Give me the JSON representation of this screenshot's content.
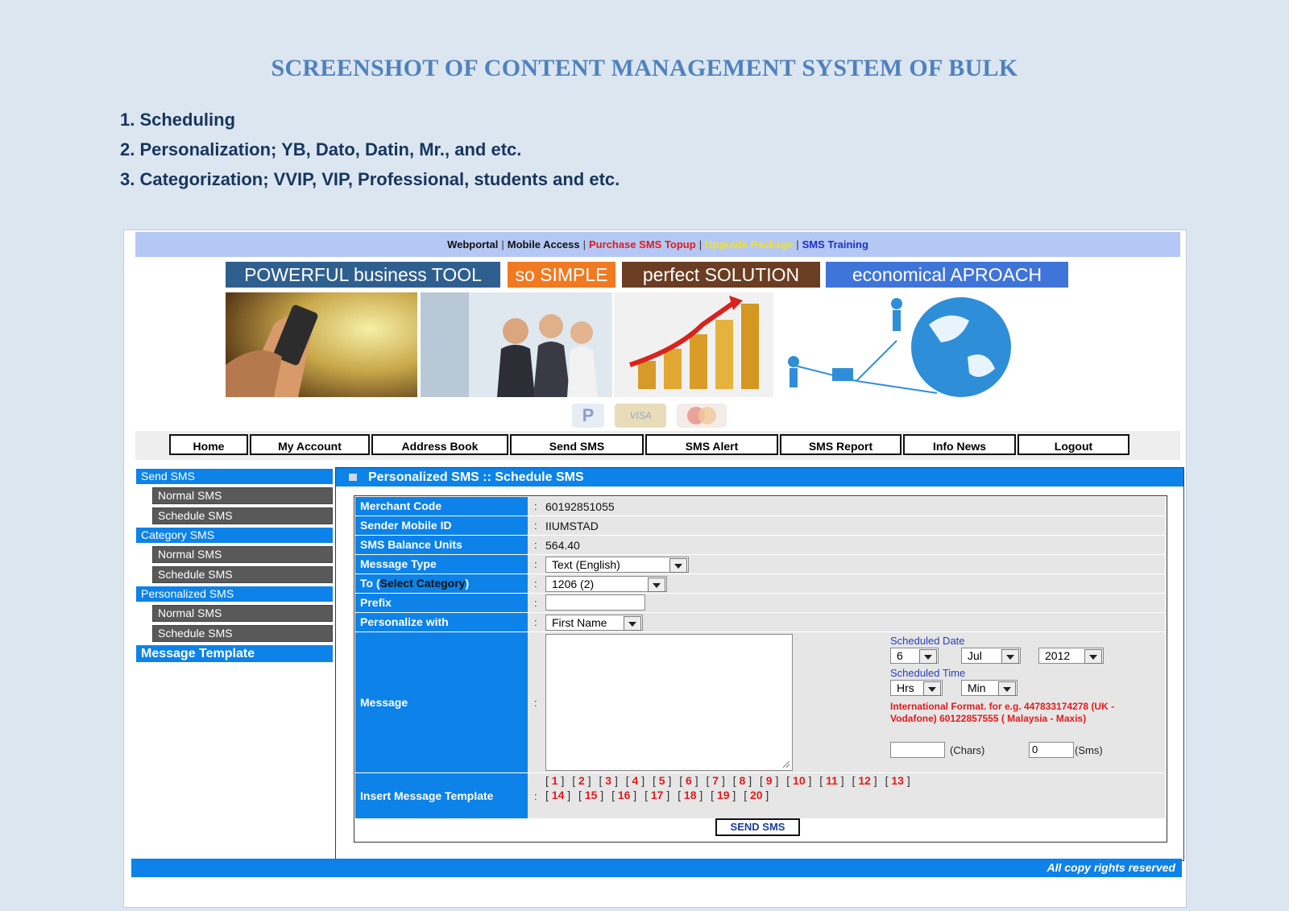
{
  "document": {
    "title": "SCREENSHOT OF CONTENT MANAGEMENT SYSTEM OF BULK",
    "points": [
      "1. Scheduling",
      "2. Personalization; YB, Dato, Datin, Mr., and etc.",
      "3. Categorization; VVIP, VIP, Professional, students and etc."
    ]
  },
  "topnav": {
    "links": [
      {
        "label": "Webportal",
        "color": "#111111"
      },
      {
        "label": "Mobile Access",
        "color": "#111111"
      },
      {
        "label": "Purchase SMS Topup",
        "color": "#e11b1b"
      },
      {
        "label": "Upgrade Package",
        "color": "#f5e11d"
      },
      {
        "label": "SMS Training",
        "color": "#1f2fc4"
      }
    ]
  },
  "banner": {
    "slogans": [
      {
        "text": "POWERFUL business TOOL",
        "color": "#2f5f8e"
      },
      {
        "text": "so SIMPLE",
        "color": "#f07a22"
      },
      {
        "text": "perfect SOLUTION",
        "color": "#6b3d22"
      },
      {
        "text": "economical APROACH",
        "color": "#3f74d9"
      }
    ],
    "payments": [
      "PayPal",
      "VISA",
      "MasterCard"
    ]
  },
  "menu": [
    "Home",
    "My Account",
    "Address Book",
    "Send SMS",
    "SMS Alert",
    "SMS Report",
    "Info News",
    "Logout"
  ],
  "sidebar": {
    "groups": [
      {
        "heading": "Send SMS",
        "items": [
          "Normal SMS",
          "Schedule SMS"
        ]
      },
      {
        "heading": "Category SMS",
        "items": [
          "Normal SMS",
          "Schedule SMS"
        ]
      },
      {
        "heading": "Personalized SMS",
        "items": [
          "Normal SMS",
          "Schedule SMS"
        ]
      }
    ],
    "template_link": "Message Template"
  },
  "panel": {
    "title": "Personalized SMS :: Schedule SMS",
    "fields": {
      "merchant_code": {
        "label": "Merchant Code",
        "value": "60192851055"
      },
      "sender_id": {
        "label": "Sender Mobile ID",
        "value": "IIUMSTAD"
      },
      "balance": {
        "label": "SMS Balance Units",
        "value": "564.40"
      },
      "message_type": {
        "label": "Message Type",
        "value": "Text (English)"
      },
      "to": {
        "label_pre": "To (",
        "label_em": "Select Category",
        "label_post": ")",
        "value": "1206 (2)"
      },
      "prefix": {
        "label": "Prefix",
        "value": ""
      },
      "personalize": {
        "label": "Personalize with",
        "value": "First Name"
      },
      "message": {
        "label": "Message"
      },
      "template": {
        "label": "Insert Message Template"
      }
    },
    "colon": ":",
    "schedule": {
      "date_label": "Scheduled Date",
      "day": "6",
      "month": "Jul",
      "year": "2012",
      "time_label": "Scheduled Time",
      "hours": "Hrs",
      "minutes": "Min",
      "note": "International Format. for e.g. 447833174278 (UK - Vodafone) 60122857555 ( Malaysia - Maxis)",
      "chars_label": "(Chars)",
      "chars_value": "",
      "sms_label": "(Sms)",
      "sms_value": "0"
    },
    "template_numbers": [
      "1",
      "2",
      "3",
      "4",
      "5",
      "6",
      "7",
      "8",
      "9",
      "10",
      "11",
      "12",
      "13",
      "14",
      "15",
      "16",
      "17",
      "18",
      "19",
      "20"
    ],
    "send_button": "SEND SMS"
  },
  "footer": "All copy rights reserved"
}
